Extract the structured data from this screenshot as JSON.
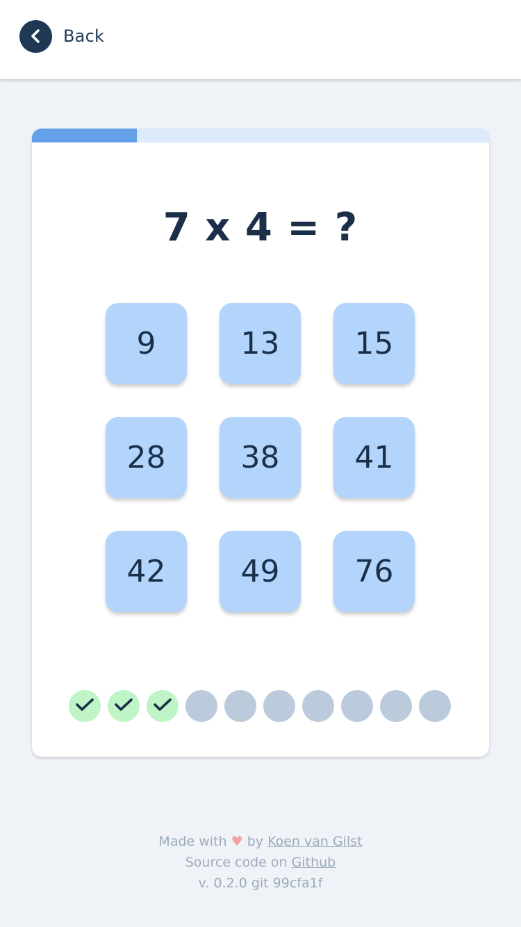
{
  "header": {
    "back_label": "Back"
  },
  "quiz": {
    "progress_fraction": 0.23,
    "question": "7 x 4 = ?",
    "answers": [
      "9",
      "13",
      "15",
      "28",
      "38",
      "41",
      "42",
      "49",
      "76"
    ],
    "results": [
      "correct",
      "correct",
      "correct",
      "pending",
      "pending",
      "pending",
      "pending",
      "pending",
      "pending",
      "pending"
    ]
  },
  "footer": {
    "made_with": "Made with",
    "heart": "♥",
    "by": "by",
    "author_link": "Koen van Gilst",
    "source_text": "Source code on",
    "source_link": "Github",
    "version": "v. 0.2.0 git 99cfa1f"
  },
  "colors": {
    "accent": "#63a0e8",
    "answer_bg": "#b3d4fb",
    "correct_bg": "#bff5c6",
    "pending_bg": "#bccbdc",
    "text_dark": "#1b2f48"
  },
  "icons": {
    "back": "chevron-left-icon",
    "correct": "checkmark-icon"
  }
}
